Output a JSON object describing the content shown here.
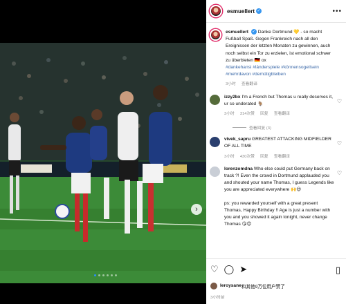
{
  "post": {
    "username": "esmuellert",
    "caption_user": "esmuellert",
    "caption_text": "Danke Dortmund 💛 - so macht Fußball Spaß. Gegen Frankreich nach all den Ereignissen der letzten Monaten zu gewinnen, auch noch selbst ein Tor zu erzielen, ist emotional schwer zu überbieten 🇩🇪 ox",
    "hashtags": "#dankehansi #länderspiele #könnensogeilsein #mehrdavon #demütigbleiben",
    "time": "3小时",
    "translate": "查看翻译",
    "more_icon": "more-dots-icon",
    "verified_icon": "verified-badge-icon"
  },
  "comments": [
    {
      "user": "izzy2bx",
      "text": "I'm a French but Thomas u really deserves it, ur so underated 🐐",
      "time": "3小时",
      "likes": "314次赞",
      "reply": "回复",
      "translate": "查看翻译",
      "avatar_color": "#556b3a"
    },
    {
      "user": "vivek_sapru",
      "text": "GREATEST ATTACKING MIDFIELDER OF ALL TIME",
      "time": "3小时",
      "likes": "430次赞",
      "reply": "回复",
      "translate": "查看翻译",
      "avatar_color": "#2a3f6e"
    },
    {
      "user": "lorenzomdna",
      "text": "Who else could put Germany back on track ?! Even the crowd in Dortmund applauded you and shouted your name Thomas, I guess Legends like you are appreciated everywhere 🙌😍",
      "text2": "ps: you rewarded yourself with a great present Thomas, Happy Birthday !! Age is just a number with you and you showed it again tonight, never change Thomas 😘😍",
      "avatar_color": "#c9ced6"
    }
  ],
  "view_replies": "查看回复 (3)",
  "actions": {
    "like_icon": "heart-outline-icon",
    "comment_icon": "comment-icon",
    "share_icon": "send-icon",
    "save_icon": "bookmark-icon"
  },
  "likes_line": {
    "user": "leroysane",
    "text": "和其他9万位用户赞了"
  },
  "ago": "3小时前",
  "carousel": {
    "current": 1,
    "total": 6
  }
}
